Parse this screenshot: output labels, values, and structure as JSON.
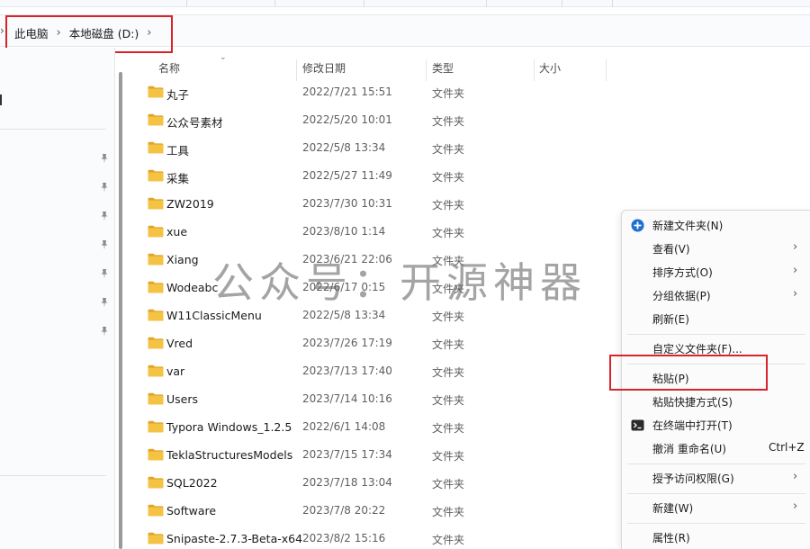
{
  "breadcrumb": {
    "items": [
      "此电脑",
      "本地磁盘 (D:)"
    ]
  },
  "columns": {
    "name": "名称",
    "date": "修改日期",
    "type": "类型",
    "size": "大小"
  },
  "files": [
    {
      "name": "丸子",
      "date": "2022/7/21 15:51",
      "type": "文件夹"
    },
    {
      "name": "公众号素材",
      "date": "2022/5/20 10:01",
      "type": "文件夹"
    },
    {
      "name": "工具",
      "date": "2022/5/8 13:34",
      "type": "文件夹"
    },
    {
      "name": "采集",
      "date": "2022/5/27 11:49",
      "type": "文件夹"
    },
    {
      "name": "ZW2019",
      "date": "2023/7/30 10:31",
      "type": "文件夹"
    },
    {
      "name": "xue",
      "date": "2023/8/10 1:14",
      "type": "文件夹"
    },
    {
      "name": "Xiang",
      "date": "2023/6/21 22:06",
      "type": "文件夹"
    },
    {
      "name": "Wodeabc",
      "date": "2022/6/17 0:15",
      "type": "文件夹"
    },
    {
      "name": "W11ClassicMenu",
      "date": "2022/5/8 13:34",
      "type": "文件夹"
    },
    {
      "name": "Vred",
      "date": "2023/7/26 17:19",
      "type": "文件夹"
    },
    {
      "name": "var",
      "date": "2023/7/13 17:40",
      "type": "文件夹"
    },
    {
      "name": "Users",
      "date": "2023/7/14 10:16",
      "type": "文件夹"
    },
    {
      "name": "Typora Windows_1.2.5",
      "date": "2022/6/1 14:08",
      "type": "文件夹"
    },
    {
      "name": "TeklaStructuresModels",
      "date": "2023/7/15 17:34",
      "type": "文件夹"
    },
    {
      "name": "SQL2022",
      "date": "2023/7/18 13:04",
      "type": "文件夹"
    },
    {
      "name": "Software",
      "date": "2023/7/8 20:22",
      "type": "文件夹"
    },
    {
      "name": "Snipaste-2.7.3-Beta-x64",
      "date": "2023/8/2 15:16",
      "type": "文件夹"
    }
  ],
  "watermark": "公众号：开源神器",
  "context_menu": {
    "items": [
      {
        "label": "新建文件夹(N)",
        "icon": "new-folder-icon"
      },
      {
        "label": "查看(V)",
        "has_submenu": true
      },
      {
        "label": "排序方式(O)",
        "has_submenu": true
      },
      {
        "label": "分组依据(P)",
        "has_submenu": true
      },
      {
        "label": "刷新(E)"
      },
      {
        "label": "自定义文件夹(F)..."
      },
      {
        "label": "粘贴(P)"
      },
      {
        "label": "粘贴快捷方式(S)"
      },
      {
        "label": "在终端中打开(T)",
        "icon": "terminal-icon"
      },
      {
        "label": "撤消 重命名(U)",
        "shortcut": "Ctrl+Z"
      },
      {
        "label": "授予访问权限(G)",
        "has_submenu": true
      },
      {
        "label": "新建(W)",
        "has_submenu": true
      },
      {
        "label": "属性(R)"
      }
    ]
  },
  "colors": {
    "highlight_box": "#d9232a",
    "folder_yellow": "#f5c343",
    "folder_dark": "#e0a526",
    "accent_blue": "#1f6fd1"
  }
}
